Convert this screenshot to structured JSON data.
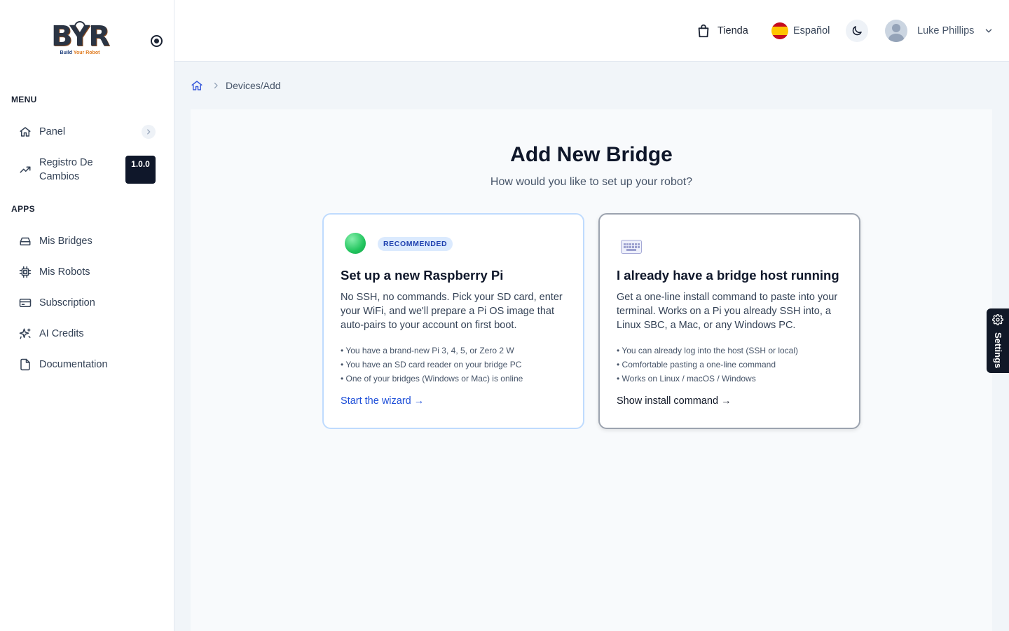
{
  "brand": {
    "logo_letters": "BYR",
    "logo_tagline_a": "Build ",
    "logo_tagline_b": "Your Robot"
  },
  "sidebar": {
    "menu_label": "MENU",
    "apps_label": "APPS",
    "menu_items": [
      {
        "label": "Panel",
        "icon": "home-icon"
      },
      {
        "label": "Registro De Cambios",
        "icon": "trending-up-icon",
        "badge": "1.0.0"
      }
    ],
    "app_items": [
      {
        "label": "Mis Bridges",
        "icon": "hard-drive-icon"
      },
      {
        "label": "Mis Robots",
        "icon": "chip-icon"
      },
      {
        "label": "Subscription",
        "icon": "credit-card-icon"
      },
      {
        "label": "AI Credits",
        "icon": "sparkles-icon"
      },
      {
        "label": "Documentation",
        "icon": "document-icon"
      }
    ]
  },
  "header": {
    "store_label": "Tienda",
    "language_label": "Español",
    "user_name": "Luke Phillips"
  },
  "breadcrumb": {
    "path": "Devices/Add"
  },
  "main": {
    "title": "Add New Bridge",
    "subtitle": "How would you like to set up your robot?",
    "cards": [
      {
        "badge": "RECOMMENDED",
        "title": "Set up a new Raspberry Pi",
        "description": "No SSH, no commands. Pick your SD card, enter your WiFi, and we'll prepare a Pi OS image that auto-pairs to your account on first boot.",
        "points": [
          "• You have a brand-new Pi 3, 4, 5, or Zero 2 W",
          "• You have an SD card reader on your bridge PC",
          "• One of your bridges (Windows or Mac) is online"
        ],
        "link": "Start the wizard →"
      },
      {
        "title": "I already have a bridge host running",
        "description": "Get a one-line install command to paste into your terminal. Works on a Pi you already SSH into, a Linux SBC, a Mac, or any Windows PC.",
        "points": [
          "• You can already log into the host (SSH or local)",
          "• Comfortable pasting a one-line command",
          "• Works on Linux / macOS / Windows"
        ],
        "link": "Show install command →"
      }
    ]
  },
  "settings_tab": {
    "label": "Settings"
  },
  "colors": {
    "accent_blue": "#1d4ed8",
    "badge_dark": "#0f172a",
    "recommended_bg": "#dbeafe"
  }
}
